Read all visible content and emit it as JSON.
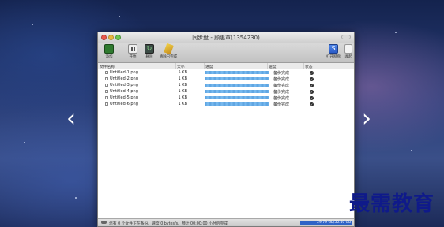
{
  "window": {
    "title": "同步盘 - 顾惠章(1354230)"
  },
  "toolbar": {
    "add_label": "添加",
    "pause_label": "开始",
    "sync_label": "删除",
    "clear_label": "清除已完成",
    "open_label": "打开网盘",
    "collapse_label": "收起"
  },
  "table": {
    "headers": {
      "name": "文件名称",
      "size": "大小",
      "progress": "进度",
      "speed": "速度",
      "status": "状态"
    },
    "rows": [
      {
        "name": "Untitled-1.png",
        "size": "5 KB",
        "progress": 1.0,
        "state": "备份完成"
      },
      {
        "name": "Untitled-2.png",
        "size": "1 KB",
        "progress": 1.0,
        "state": "备份完成"
      },
      {
        "name": "Untitled-3.png",
        "size": "1 KB",
        "progress": 1.0,
        "state": "备份完成"
      },
      {
        "name": "Untitled-4.png",
        "size": "1 KB",
        "progress": 1.0,
        "state": "备份完成"
      },
      {
        "name": "Untitled-5.png",
        "size": "1 KB",
        "progress": 1.0,
        "state": "备份完成"
      },
      {
        "name": "Untitled-6.png",
        "size": "1 KB",
        "progress": 1.0,
        "state": "备份完成"
      }
    ]
  },
  "statusbar": {
    "text": "您有 0 个文件正在备份。速度 0 bytes/s。预计 00:00:00 小时后完成",
    "quota": "29.79 Gb/50.40 Gb"
  },
  "nav": {
    "prev": "‹",
    "next": "›"
  },
  "watermark": "最需教育",
  "icons": {
    "add": "add-icon",
    "pause": "pause-icon",
    "sync": "sync-icon",
    "clear": "broom-icon",
    "open": "open-disk-icon",
    "collapse": "collapse-icon",
    "check": "check-icon",
    "cloud": "cloud-icon"
  },
  "colors": {
    "progress": "#5aa2e0",
    "quota": "#2f63c6",
    "watermark": "#0f1a8a"
  }
}
